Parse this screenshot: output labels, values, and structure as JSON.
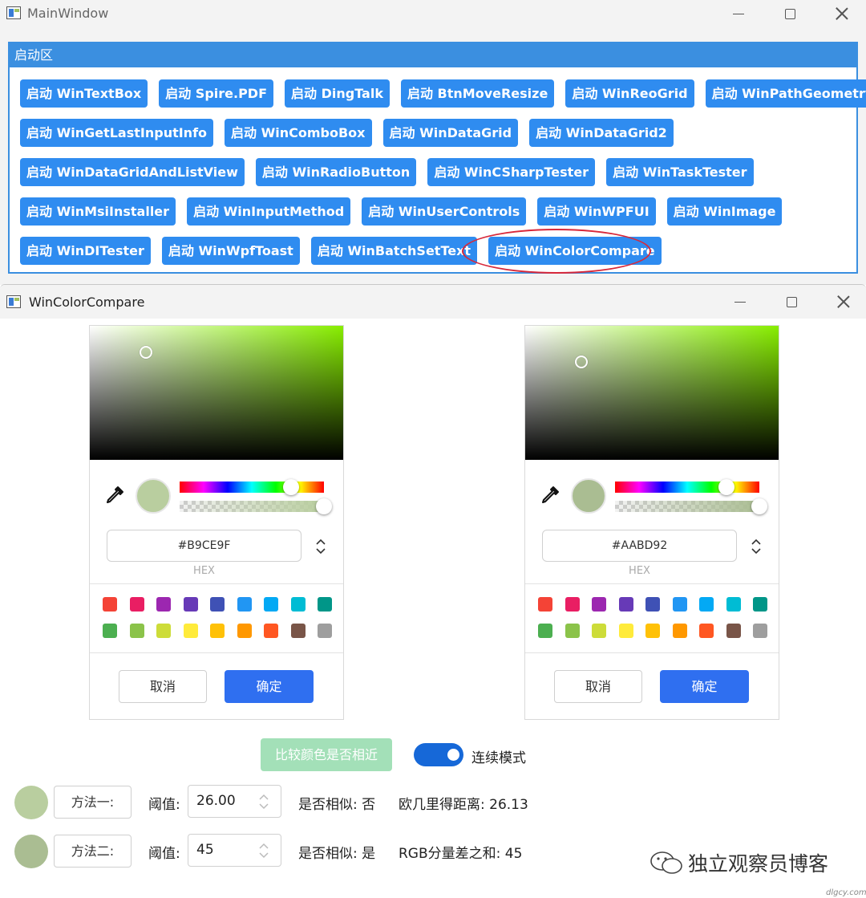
{
  "main_window": {
    "title": "MainWindow",
    "group_title": "启动区",
    "button_rows": [
      [
        "启动 WinTextBox",
        "启动 Spire.PDF",
        "启动 DingTalk",
        "启动 BtnMoveResize",
        "启动 WinReoGrid",
        "启动 WinPathGeometry"
      ],
      [
        "启动 WinGetLastInputInfo",
        "启动 WinComboBox",
        "启动 WinDataGrid",
        "启动 WinDataGrid2"
      ],
      [
        "启动 WinDataGridAndListView",
        "启动 WinRadioButton",
        "启动 WinCSharpTester",
        "启动 WinTaskTester"
      ],
      [
        "启动 WinMsiInstaller",
        "启动 WinInputMethod",
        "启动 WinUserControls",
        "启动 WinWPFUI",
        "启动 WinImage"
      ],
      [
        "启动 WinDITester",
        "启动 WinWpfToast",
        "启动 WinBatchSetText",
        "启动 WinColorCompare"
      ]
    ]
  },
  "color_window": {
    "title": "WinColorCompare",
    "pickers": [
      {
        "hex": "#B9CE9F",
        "hex_label": "HEX",
        "color": "#B9CE9F",
        "hue_position": 0.77,
        "alpha": 1.0
      },
      {
        "hex": "#AABD92",
        "hex_label": "HEX",
        "color": "#AABD92",
        "hue_position": 0.77,
        "alpha": 1.0
      }
    ],
    "swatches": [
      "#f44336",
      "#e91e63",
      "#9c27b0",
      "#673ab7",
      "#3f51b5",
      "#2196f3",
      "#03a9f4",
      "#00bcd4",
      "#009688",
      "#4caf50",
      "#8bc34a",
      "#cddc39",
      "#ffeb3b",
      "#ffc107",
      "#ff9800",
      "#ff5722",
      "#795548",
      "#9e9e9e"
    ],
    "cancel_label": "取消",
    "ok_label": "确定",
    "compare_button": "比较颜色是否相近",
    "toggle_label": "连续模式",
    "toggle_on": true,
    "methods": [
      {
        "dot_color": "#B9CE9F",
        "button": "方法一:",
        "threshold_label": "阈值:",
        "threshold": "26.00",
        "similar_label": "是否相似:",
        "similar_value": "否",
        "metric_label": "欧几里得距离:",
        "metric_value": "26.13"
      },
      {
        "dot_color": "#AABD92",
        "button": "方法二:",
        "threshold_label": "阈值:",
        "threshold": "45",
        "similar_label": "是否相似:",
        "similar_value": "是",
        "metric_label": "RGB分量差之和:",
        "metric_value": "45"
      }
    ]
  },
  "watermark": {
    "text": "独立观察员博客",
    "site": "dlgcy.com"
  }
}
